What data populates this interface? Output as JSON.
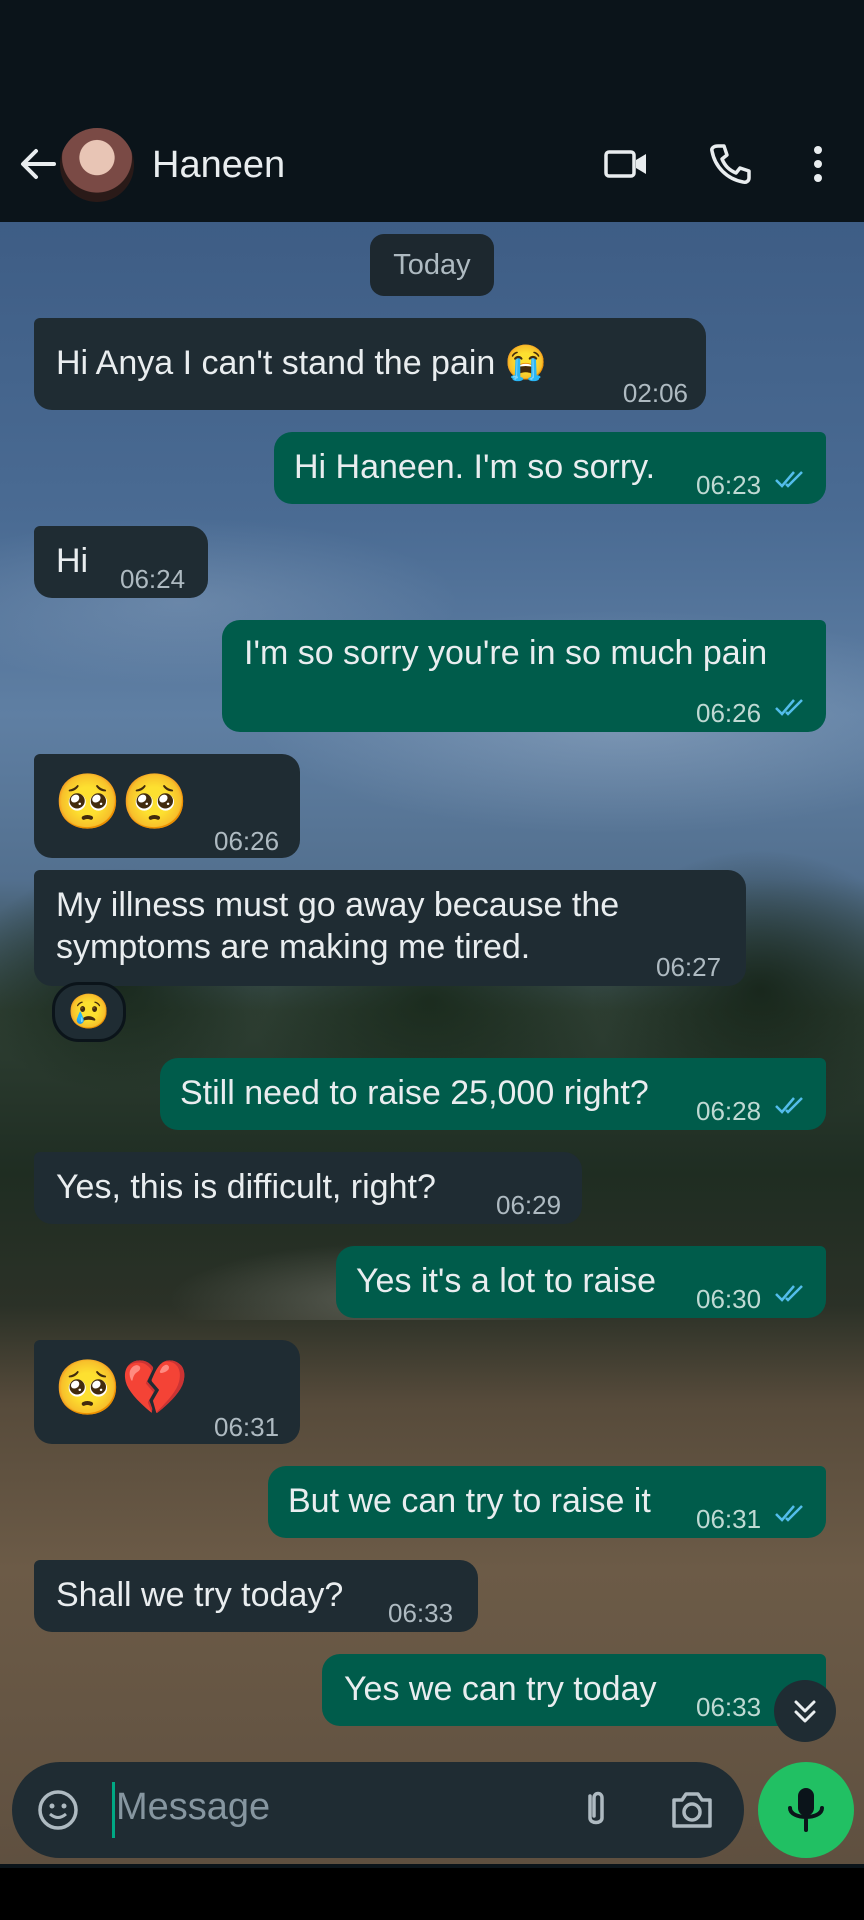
{
  "header": {
    "contact_name": "Haneen"
  },
  "date_chip": "Today",
  "messages": [
    {
      "dir": "in",
      "text": "Hi Anya I can't stand the pain",
      "emoji": "😭",
      "time": "02:06"
    },
    {
      "dir": "out",
      "text": "Hi Haneen. I'm so sorry.",
      "time": "06:23"
    },
    {
      "dir": "in",
      "text": "Hi",
      "time": "06:24"
    },
    {
      "dir": "out",
      "text": "I'm so sorry you're in so much pain",
      "time": "06:26"
    },
    {
      "dir": "in",
      "text": "🥺🥺",
      "time": "06:26"
    },
    {
      "dir": "in",
      "text_line1": "My illness must go away because the",
      "text_line2": "symptoms are making me tired.",
      "time": "06:27",
      "reaction": "😢"
    },
    {
      "dir": "out",
      "text": "Still need to raise 25,000 right?",
      "time": "06:28"
    },
    {
      "dir": "in",
      "text": "Yes, this is difficult, right?",
      "time": "06:29"
    },
    {
      "dir": "out",
      "text": "Yes it's a lot to raise",
      "time": "06:30"
    },
    {
      "dir": "in",
      "text": "🥺💔",
      "time": "06:31"
    },
    {
      "dir": "out",
      "text": "But we can try to raise it",
      "time": "06:31"
    },
    {
      "dir": "in",
      "text": "Shall we try today?",
      "time": "06:33"
    },
    {
      "dir": "out",
      "text": "Yes we can try today",
      "time": "06:33"
    }
  ],
  "composer": {
    "placeholder": "Message"
  },
  "icons": {
    "back": "arrow-left-icon",
    "video": "video-call-icon",
    "call": "phone-icon",
    "more": "more-vert-icon",
    "emoji": "emoji-icon",
    "attach": "paperclip-icon",
    "camera": "camera-icon",
    "mic": "mic-icon",
    "scroll": "chevrons-down-icon"
  },
  "colors": {
    "incoming_bubble": "#1f2c33",
    "outgoing_bubble": "#005c4b",
    "mic_button": "#21c063",
    "read_ticks": "#53bdeb"
  }
}
